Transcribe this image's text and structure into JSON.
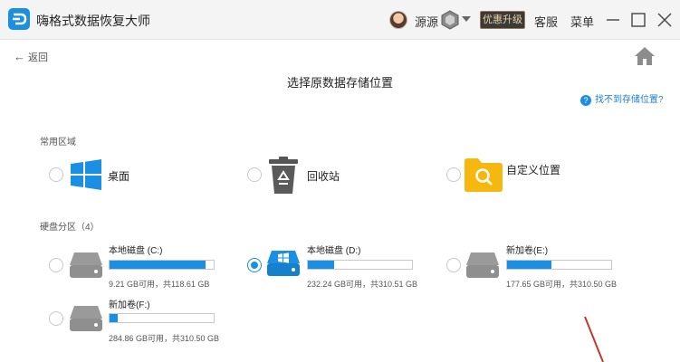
{
  "titlebar": {
    "title": "嗨格式数据恢复大师",
    "username": "源源",
    "upgrade_label": "优惠升级",
    "service_label": "客服",
    "menu_label": "菜单"
  },
  "toolbar": {
    "back_label": "返回"
  },
  "page": {
    "title": "选择原数据存储位置",
    "help_label": "找不到存储位置?"
  },
  "common": {
    "section_label": "常用区域",
    "items": [
      {
        "label": "桌面",
        "icon": "windows-icon"
      },
      {
        "label": "回收站",
        "icon": "recycle-bin-icon"
      },
      {
        "label": "自定义位置",
        "icon": "folder-search-icon"
      }
    ]
  },
  "partitions": {
    "section_label": "硬盘分区（4）",
    "drives": [
      {
        "name": "本地磁盘 (C:)",
        "size": "9.21 GB可用，共118.61 GB",
        "used_fraction": 0.92,
        "selected": false
      },
      {
        "name": "本地磁盘 (D:)",
        "size": "232.24 GB可用，共310.51 GB",
        "used_fraction": 0.25,
        "selected": true
      },
      {
        "name": "新加卷(E:)",
        "size": "177.65 GB可用，共310.50 GB",
        "used_fraction": 0.43,
        "selected": false
      },
      {
        "name": "新加卷(F:)",
        "size": "284.86 GB可用，共310.50 GB",
        "used_fraction": 0.08,
        "selected": false
      }
    ]
  },
  "colors": {
    "accent": "#1a8fe3",
    "folder": "#f6b80f",
    "drive_gray": "#9a9a9a",
    "annotation_red": "#c0392b"
  }
}
